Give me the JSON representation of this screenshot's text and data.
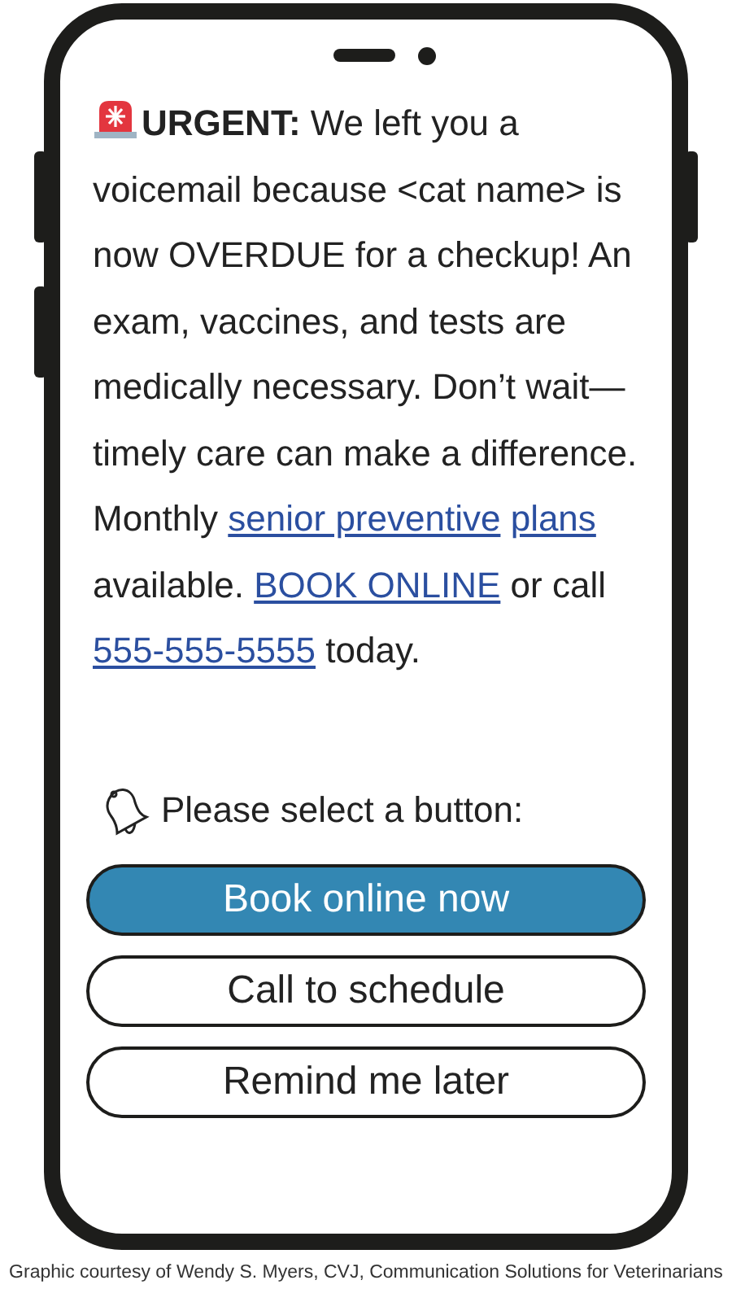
{
  "message": {
    "parts": [
      {
        "kind": "bold",
        "text": "URGENT:"
      },
      {
        "kind": "text",
        "text": " We left you a voicemail because <cat name> is now OVERDUE for a checkup! An exam, vaccines, and tests are medically necessary. Don’t wait—timely care can make a difference. Monthly "
      },
      {
        "kind": "link",
        "text": "senior preventive"
      },
      {
        "kind": "link",
        "text": "plans"
      },
      {
        "kind": "text",
        "text": " available. "
      },
      {
        "kind": "link",
        "text": "BOOK ONLINE"
      },
      {
        "kind": "text",
        "text": " or call "
      },
      {
        "kind": "link",
        "text": "555-555-5555"
      },
      {
        "kind": "text",
        "text": " today."
      }
    ]
  },
  "prompt": "Please select a button:",
  "buttons": [
    {
      "label": "Book online now",
      "selected": true
    },
    {
      "label": "Call to schedule",
      "selected": false
    },
    {
      "label": "Remind me later",
      "selected": false
    }
  ],
  "caption": "Graphic courtesy of Wendy S. Myers, CVJ, Communication Solutions for Veterinarians"
}
